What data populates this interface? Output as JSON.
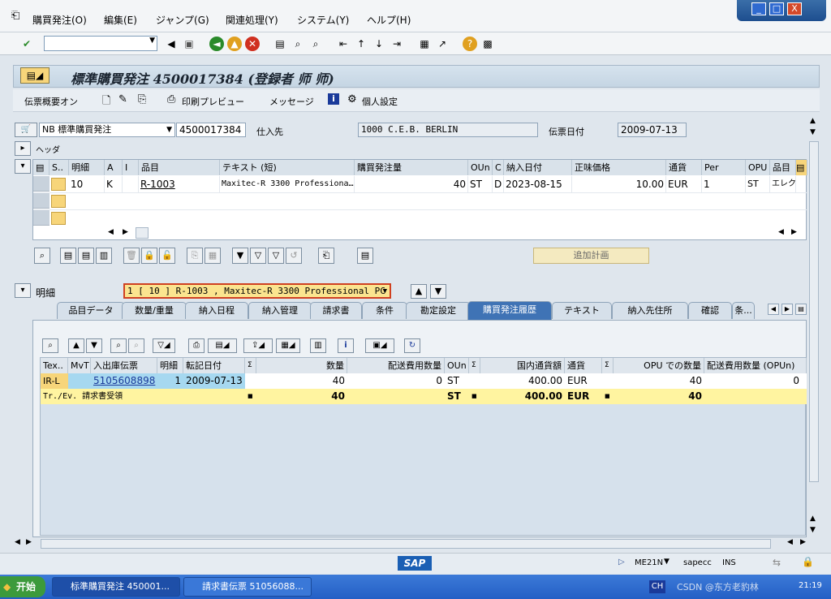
{
  "menu": {
    "items": [
      "購買発注(O)",
      "編集(E)",
      "ジャンプ(G)",
      "関連処理(Y)",
      "システム(Y)",
      "ヘルプ(H)"
    ]
  },
  "window": {
    "minimize": "_",
    "restore": "□",
    "close": "X"
  },
  "toolbar": {
    "command_value": ""
  },
  "title": {
    "text": "標準購買発注 4500017384 (登録者 师 师)"
  },
  "app_toolbar": {
    "doc_overview": "伝票概要オン",
    "print_preview": "印刷プレビュー",
    "messages": "メッセージ",
    "personal_settings": "個人設定"
  },
  "header": {
    "doc_type": "NB 標準購買発注",
    "po_number": "4500017384",
    "vendor_label": "仕入先",
    "vendor_value": "1000 C.E.B. BERLIN",
    "doc_date_label": "伝票日付",
    "doc_date_value": "2009-07-13",
    "header_section": "ヘッダ"
  },
  "item_grid": {
    "columns": [
      "S..",
      "明細",
      "A",
      "I",
      "品目",
      "テキスト (短)",
      "購買発注量",
      "OUn",
      "C",
      "納入日付",
      "正味価格",
      "通貨",
      "Per",
      "OPU",
      "品目"
    ],
    "rows": [
      [
        "",
        "10",
        "K",
        "",
        "R-1003",
        "Maxitec-R 3300 Professiona…",
        "40",
        "ST",
        "D",
        "2023-08-15",
        "10.00",
        "EUR",
        "1",
        "ST",
        "エレク"
      ]
    ]
  },
  "add_planning": "追加計画",
  "detail": {
    "label": "明細",
    "selected": "1 [ 10 ] R-1003 , Maxitec-R 3300 Professional PC"
  },
  "tabs": [
    "品目データ",
    "数量/重量",
    "納入日程",
    "納入管理",
    "請求書",
    "条件",
    "勘定設定",
    "購買発注履歴",
    "テキスト",
    "納入先住所",
    "確認",
    "条..."
  ],
  "history_grid": {
    "columns": [
      "Tex..",
      "MvT",
      "入出庫伝票",
      "明細",
      "転記日付",
      "Σ",
      "数量",
      "配送費用数量",
      "OUn",
      "Σ",
      "国内通貨額",
      "通貨",
      "Σ",
      "OPU での数量",
      "配送費用数量 (OPUn)"
    ],
    "row": {
      "tex": "IR-L",
      "mvt": "",
      "doc": "5105608898",
      "item": "1",
      "date": "2009-07-13",
      "qty": "40",
      "del_qty": "0",
      "oun": "ST",
      "amount": "400.00",
      "currency": "EUR",
      "opu_qty": "40",
      "del_opu": "0"
    },
    "total": {
      "label": "Tr./Ev. 請求書受領",
      "qty": "40",
      "oun": "ST",
      "amount": "400.00",
      "currency": "EUR",
      "opu_qty": "40"
    }
  },
  "status": {
    "sap": "SAP",
    "transaction": "ME21N",
    "system": "sapecc",
    "mode": "INS"
  },
  "taskbar": {
    "start": "开始",
    "task1": "标準購買発注 450001...",
    "task2": "請求書伝票 51056088...",
    "lang": "CH",
    "time": "21:19",
    "watermark": "CSDN @东方老豹林"
  },
  "colors": {
    "accent_tab": "#3f73b5",
    "selected_field": "#fbe48f",
    "total_row": "#fff4a0"
  }
}
